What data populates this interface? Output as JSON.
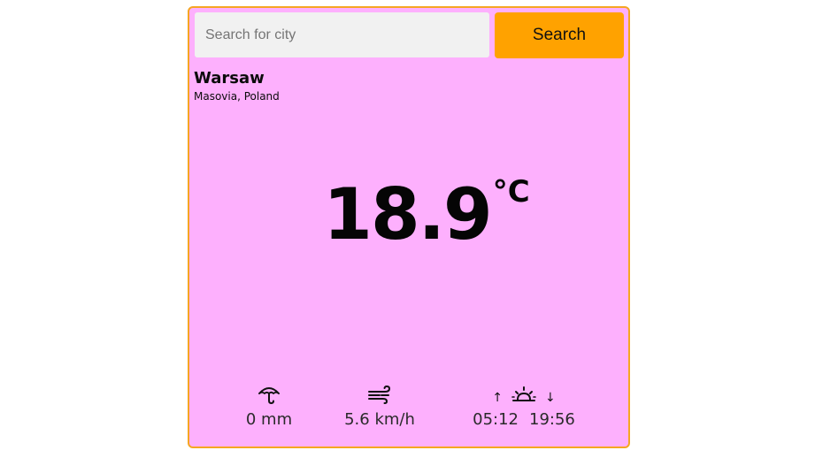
{
  "search": {
    "placeholder": "Search for city",
    "value": "",
    "button_label": "Search"
  },
  "location": {
    "city": "Warsaw",
    "region": "Masovia, Poland"
  },
  "current": {
    "temperature": "18.9",
    "unit": "°C"
  },
  "stats": {
    "precipitation": {
      "icon": "umbrella-icon",
      "value": "0 mm"
    },
    "wind": {
      "icon": "wind-icon",
      "value": "5.6 km/h"
    },
    "sun": {
      "icon": "sunrise-sunset-icon",
      "up_arrow": "↑",
      "down_arrow": "↓",
      "sunrise": "05:12",
      "sunset": "19:56"
    }
  },
  "colors": {
    "card_background": "#fdb0fd",
    "card_border": "#f5a623",
    "button_background": "#ffa200",
    "input_background": "#f1f1f1"
  }
}
